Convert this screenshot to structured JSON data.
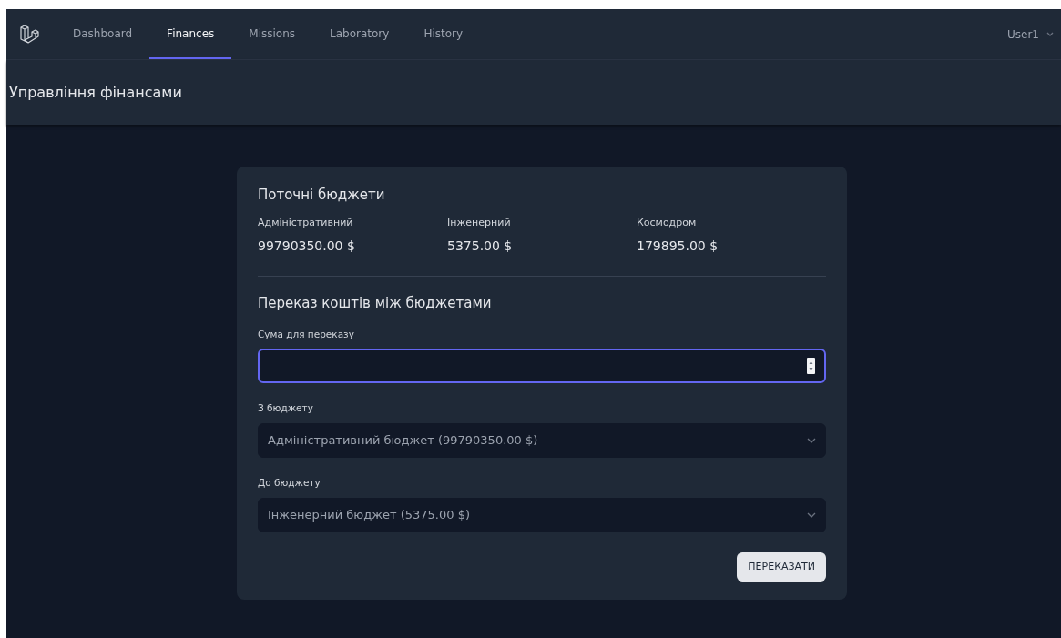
{
  "nav": {
    "links": [
      {
        "label": "Dashboard",
        "selected": false
      },
      {
        "label": "Finances",
        "selected": true
      },
      {
        "label": "Missions",
        "selected": false
      },
      {
        "label": "Laboratory",
        "selected": false
      },
      {
        "label": "History",
        "selected": false
      }
    ],
    "user": "User1"
  },
  "header": {
    "title": "Управління фінансами"
  },
  "budgets": {
    "title": "Поточні бюджети",
    "items": [
      {
        "label": "Адміністративний",
        "amount": "99790350.00 $"
      },
      {
        "label": "Інженерний",
        "amount": "5375.00 $"
      },
      {
        "label": "Космодром",
        "amount": "179895.00 $"
      }
    ]
  },
  "transfer": {
    "title": "Переказ коштів між бюджетами",
    "fields": [
      {
        "kind": "number",
        "label": "Сума для переказу",
        "focused": true
      },
      {
        "kind": "select",
        "label": "З бюджету",
        "value": "Адміністративний бюджет (99790350.00 $)",
        "focused": false
      },
      {
        "kind": "select",
        "label": "До бюджету",
        "value": "Інженерний бюджет (5375.00 $)",
        "focused": false
      }
    ],
    "button": "ПЕРЕКАЗАТИ"
  }
}
